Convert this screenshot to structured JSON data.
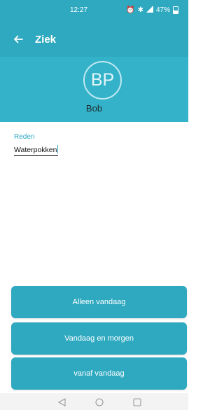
{
  "status_bar": {
    "time": "12:27",
    "battery": "47%"
  },
  "app_bar": {
    "title": "Ziek"
  },
  "profile": {
    "initials": "BP",
    "name": "Bob"
  },
  "form": {
    "reason_label": "Reden",
    "reason_value": "Waterpokken"
  },
  "actions": {
    "today_only": "Alleen vandaag",
    "today_tomorrow": "Vandaag en morgen",
    "from_today": "vanaf vandaag"
  },
  "colors": {
    "primary": "#2fa9c0",
    "header": "#34b2c9"
  }
}
